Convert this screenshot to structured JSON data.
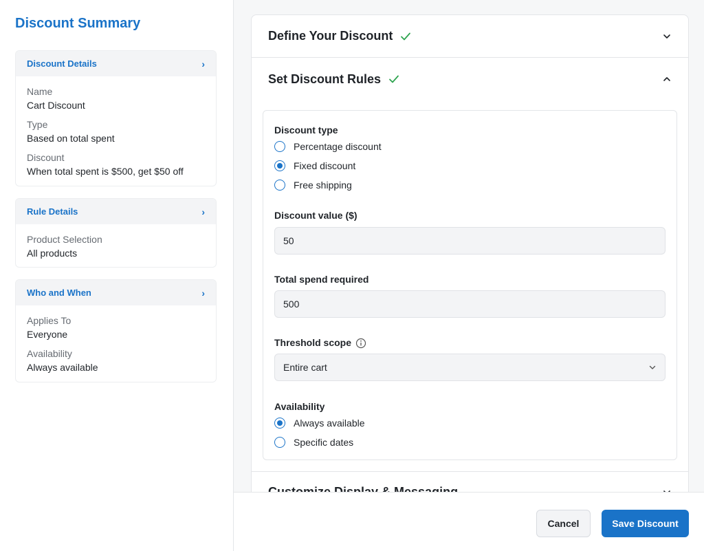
{
  "sidebar": {
    "title": "Discount Summary",
    "cards": [
      {
        "header": "Discount Details",
        "fields": [
          {
            "label": "Name",
            "value": "Cart Discount"
          },
          {
            "label": "Type",
            "value": "Based on total spent"
          },
          {
            "label": "Discount",
            "value": "When total spent is $500, get $50 off"
          }
        ]
      },
      {
        "header": "Rule Details",
        "fields": [
          {
            "label": "Product Selection",
            "value": "All products"
          }
        ]
      },
      {
        "header": "Who and When",
        "fields": [
          {
            "label": "Applies To",
            "value": "Everyone"
          },
          {
            "label": "Availability",
            "value": "Always available"
          }
        ]
      }
    ]
  },
  "main": {
    "sections": {
      "define": {
        "title": "Define Your Discount",
        "complete": true,
        "expanded": false
      },
      "rules": {
        "title": "Set Discount Rules",
        "complete": true,
        "expanded": true
      },
      "display": {
        "title": "Customize Display & Messaging",
        "expanded": false
      }
    },
    "rules": {
      "discount_type": {
        "label": "Discount type",
        "options": [
          "Percentage discount",
          "Fixed discount",
          "Free shipping"
        ],
        "selected": "Fixed discount"
      },
      "discount_value": {
        "label": "Discount value ($)",
        "value": "50"
      },
      "total_spend": {
        "label": "Total spend required",
        "value": "500"
      },
      "threshold_scope": {
        "label": "Threshold scope",
        "value": "Entire cart"
      },
      "availability": {
        "label": "Availability",
        "options": [
          "Always available",
          "Specific dates"
        ],
        "selected": "Always available"
      }
    }
  },
  "footer": {
    "cancel_label": "Cancel",
    "save_label": "Save Discount"
  },
  "colors": {
    "accent": "#1a73c8",
    "success": "#2ea44f"
  }
}
